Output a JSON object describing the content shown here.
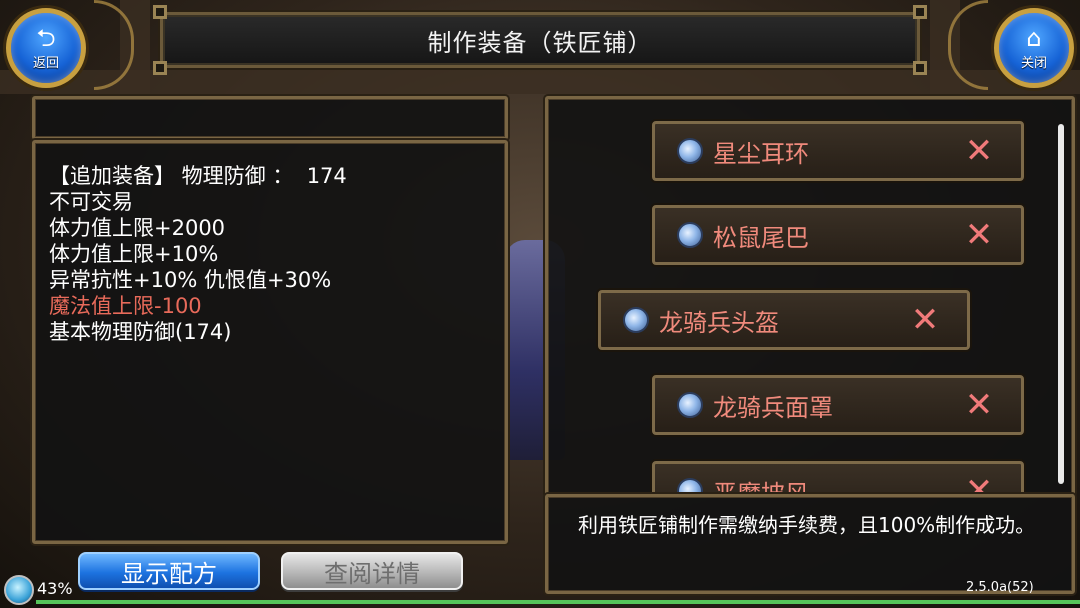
{
  "window": {
    "title": "制作装备（铁匠铺）"
  },
  "top_buttons": {
    "return_label": "返回",
    "close_label": "关闭"
  },
  "detail_panel": {
    "lines": [
      {
        "text": "【追加装备】 物理防御 ：  174",
        "color": "#ffffff"
      },
      {
        "text": "不可交易",
        "color": "#ffffff"
      },
      {
        "text": "体力值上限+2000",
        "color": "#ffffff"
      },
      {
        "text": "体力值上限+10%",
        "color": "#ffffff"
      },
      {
        "text": "异常抗性+10% 仇恨值+30%",
        "color": "#ffffff"
      },
      {
        "text": "魔法值上限-100",
        "color": "#e86a5a"
      },
      {
        "text": "基本物理防御(174)",
        "color": "#ffffff"
      }
    ]
  },
  "recipe_list": {
    "items": [
      {
        "name": "星尘耳环",
        "icon": "equipment-orb-icon",
        "selected": false
      },
      {
        "name": "松鼠尾巴",
        "icon": "equipment-orb-icon",
        "selected": false
      },
      {
        "name": "龙骑兵头盔",
        "icon": "equipment-orb-icon",
        "selected": true
      },
      {
        "name": "龙骑兵面罩",
        "icon": "equipment-orb-icon",
        "selected": false
      },
      {
        "name": "恶魔披风",
        "icon": "equipment-orb-icon",
        "selected": false
      }
    ],
    "remove_glyph": "✕"
  },
  "info_box": {
    "text": "利用铁匠铺制作需缴纳手续费，且100%制作成功。"
  },
  "buttons": {
    "show_recipe": "显示配方",
    "view_details": "查阅详情"
  },
  "status": {
    "battery": "43%",
    "version": "2.5.0a(52)",
    "progress": 1.0
  },
  "colors": {
    "accent_blue": "#1d73e0",
    "item_name": "#f08a7c",
    "frame_gold": "#7a6644"
  }
}
